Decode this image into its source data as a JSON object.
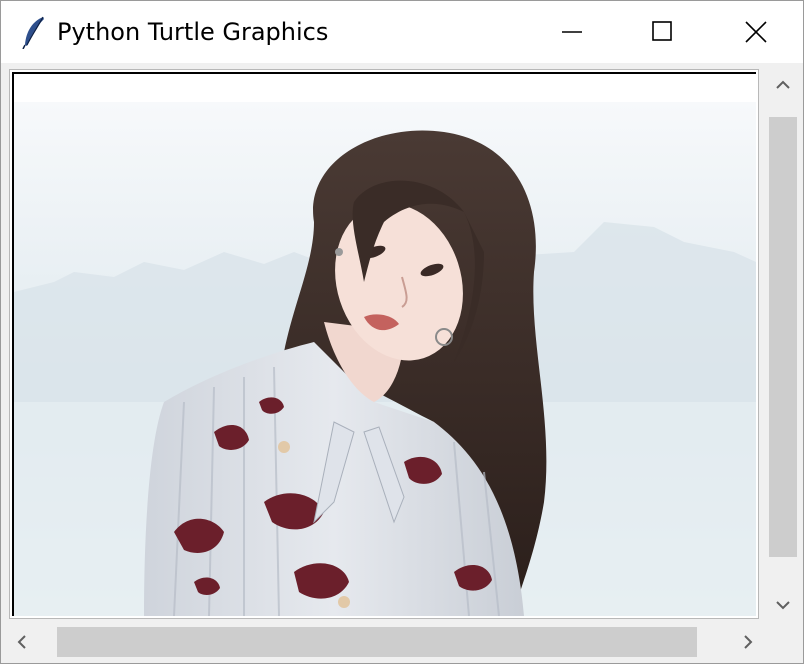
{
  "window": {
    "title": "Python Turtle Graphics",
    "icon": "feather-icon",
    "controls": [
      "minimize-icon",
      "maximize-icon",
      "close-icon"
    ]
  },
  "canvas": {
    "background": "#ffffff",
    "content": "photo"
  },
  "scrollbars": {
    "vertical": {
      "up_icon": "chevron-up-icon",
      "down_icon": "chevron-down-icon"
    },
    "horizontal": {
      "left_icon": "chevron-left-icon",
      "right_icon": "chevron-right-icon"
    }
  },
  "colors": {
    "chrome": "#f0f0f0",
    "scroll_thumb": "#cdcdcd",
    "pattern": "#6b1f2b"
  }
}
